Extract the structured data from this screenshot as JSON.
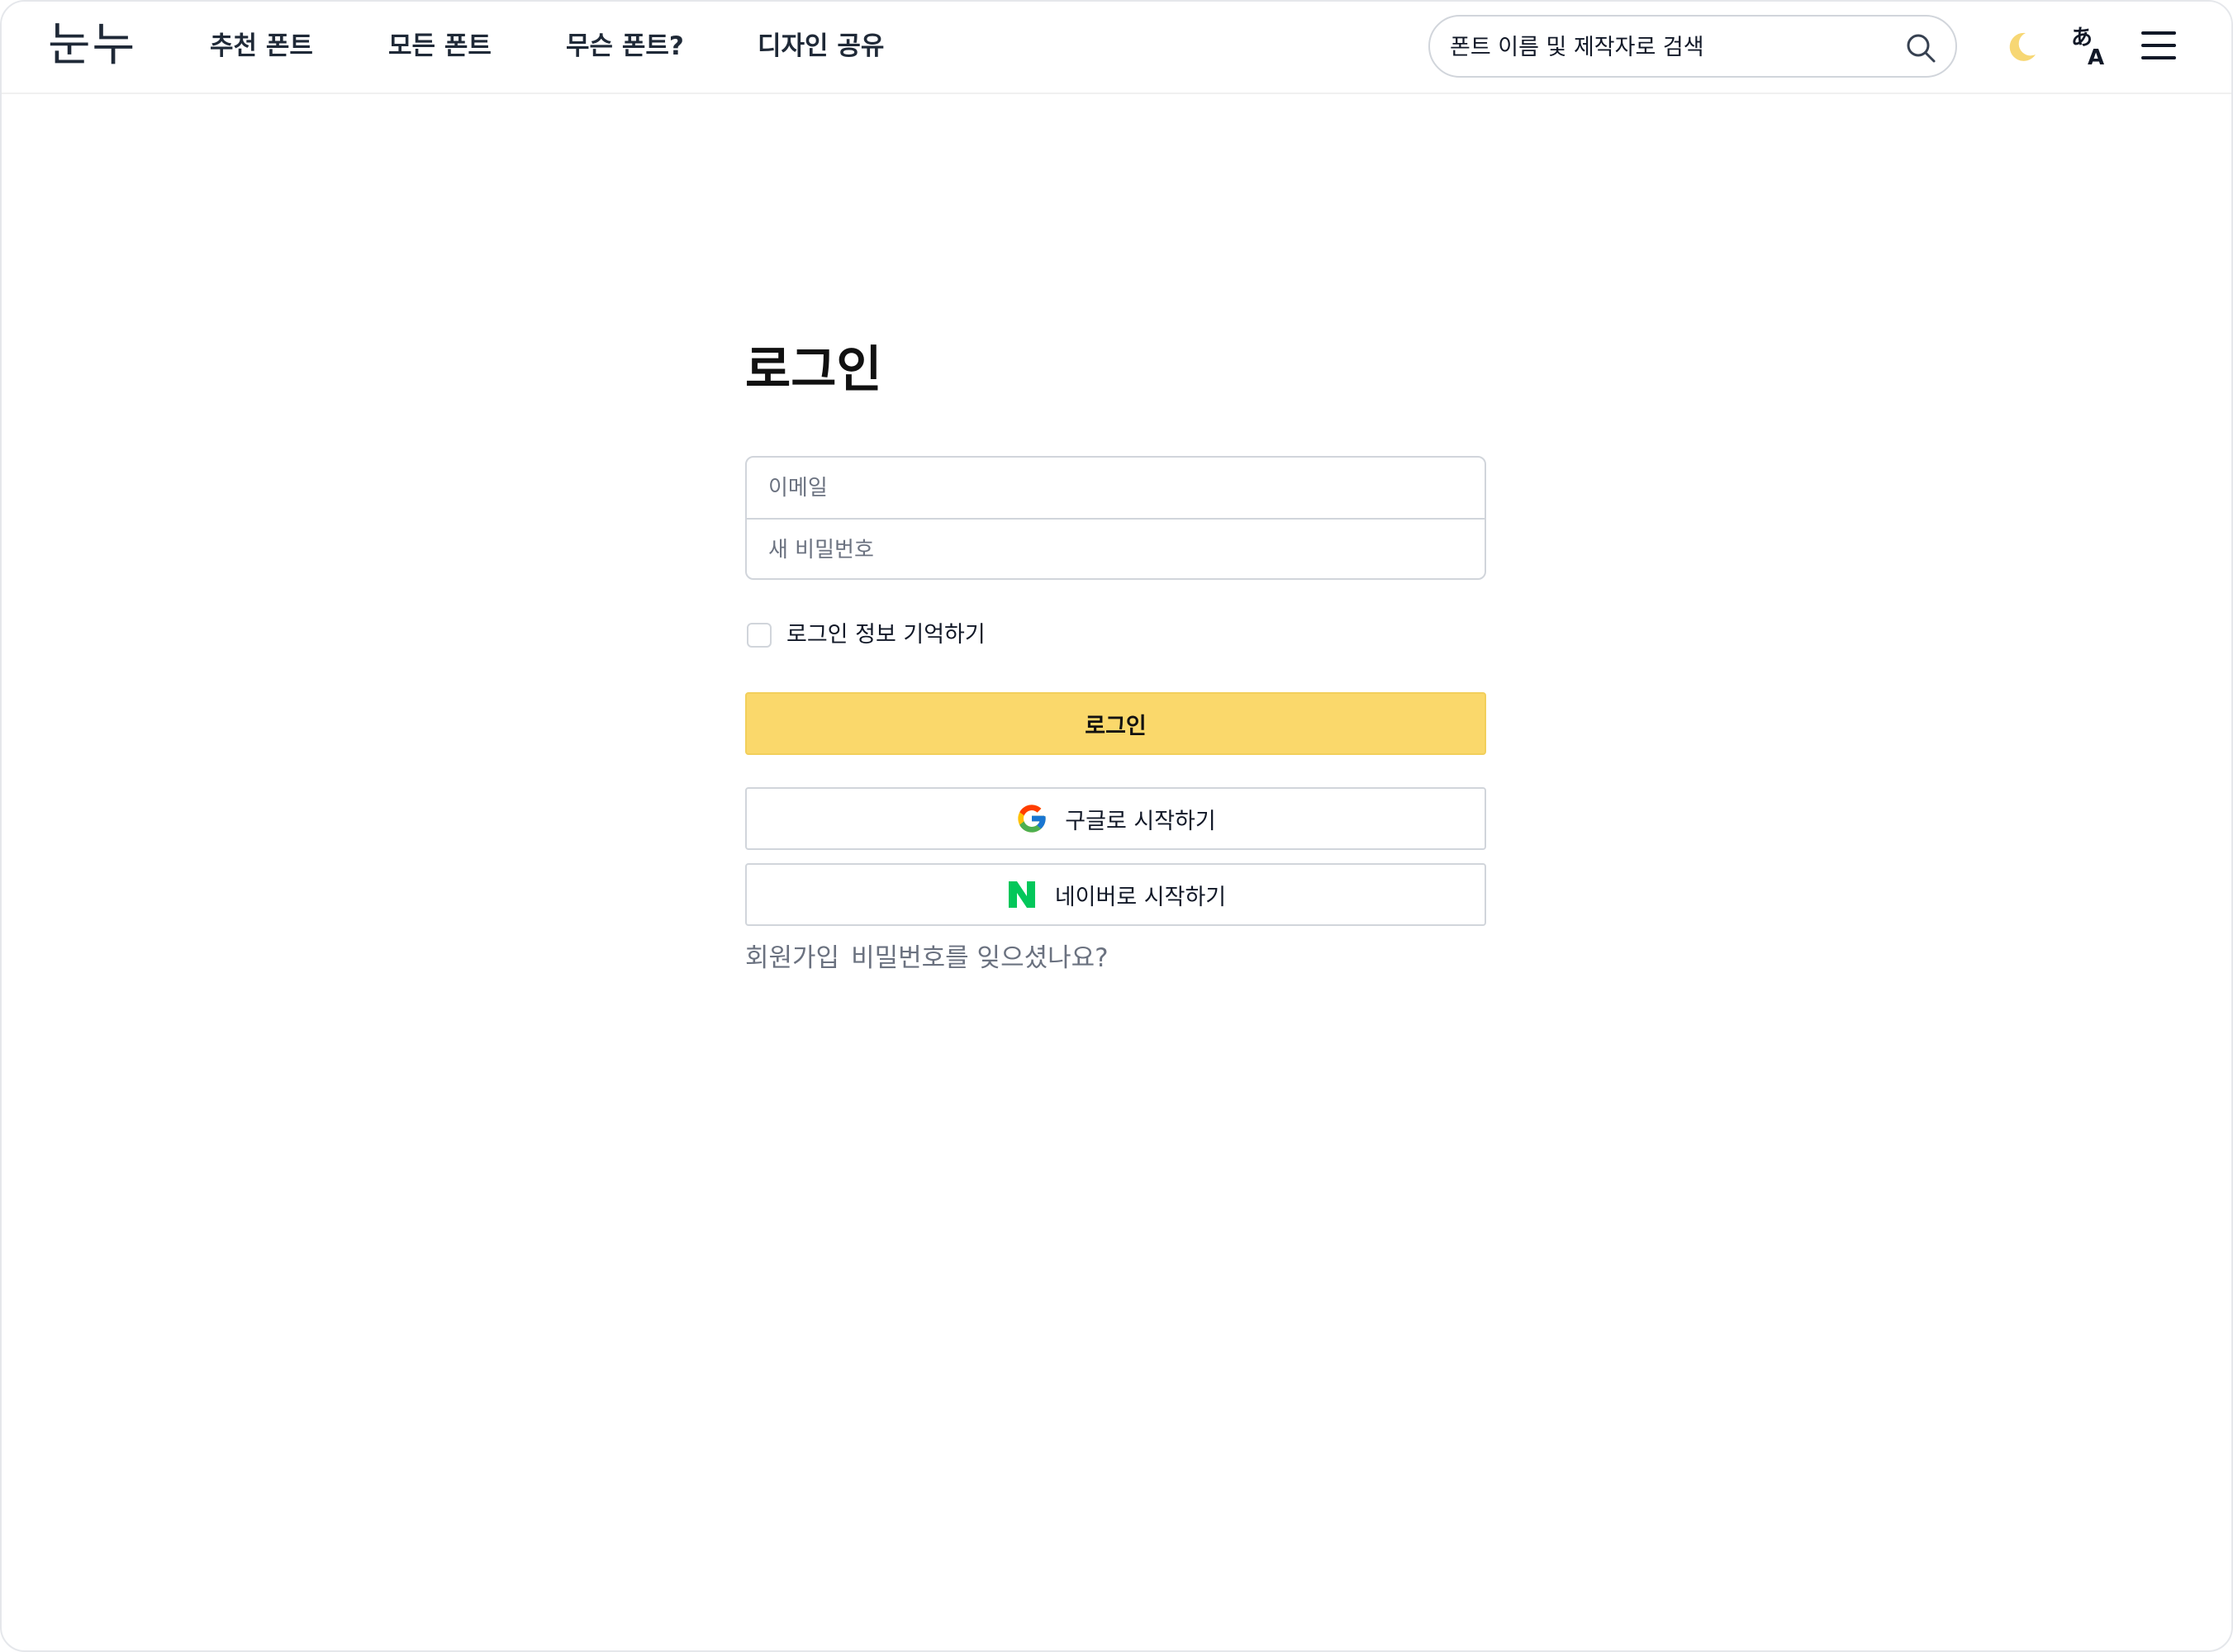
{
  "header": {
    "logo": "눈누",
    "nav": [
      {
        "label": "추천 폰트"
      },
      {
        "label": "모든 폰트"
      },
      {
        "label": "무슨 폰트?"
      },
      {
        "label": "디자인 공유"
      }
    ],
    "search": {
      "placeholder": "폰트 이름 및 제작자로 검색",
      "icon": "search-icon"
    },
    "icons": [
      "moon-icon",
      "translate-icon",
      "menu-icon"
    ]
  },
  "main": {
    "title": "로그인",
    "email_placeholder": "이메일",
    "password_placeholder": "새 비밀번호",
    "remember_label": "로그인 정보 기억하기",
    "remember_checked": false,
    "login_button": "로그인",
    "google_button": "구글로 시작하기",
    "naver_button": "네이버로 시작하기",
    "links": {
      "signup": "회원가입",
      "forgot_password": "비밀번호를 잊으셨나요?"
    }
  },
  "colors": {
    "accent": "#fad86b",
    "moon": "#f7d774",
    "naver": "#03c75a",
    "muted_text": "#6b7280"
  }
}
